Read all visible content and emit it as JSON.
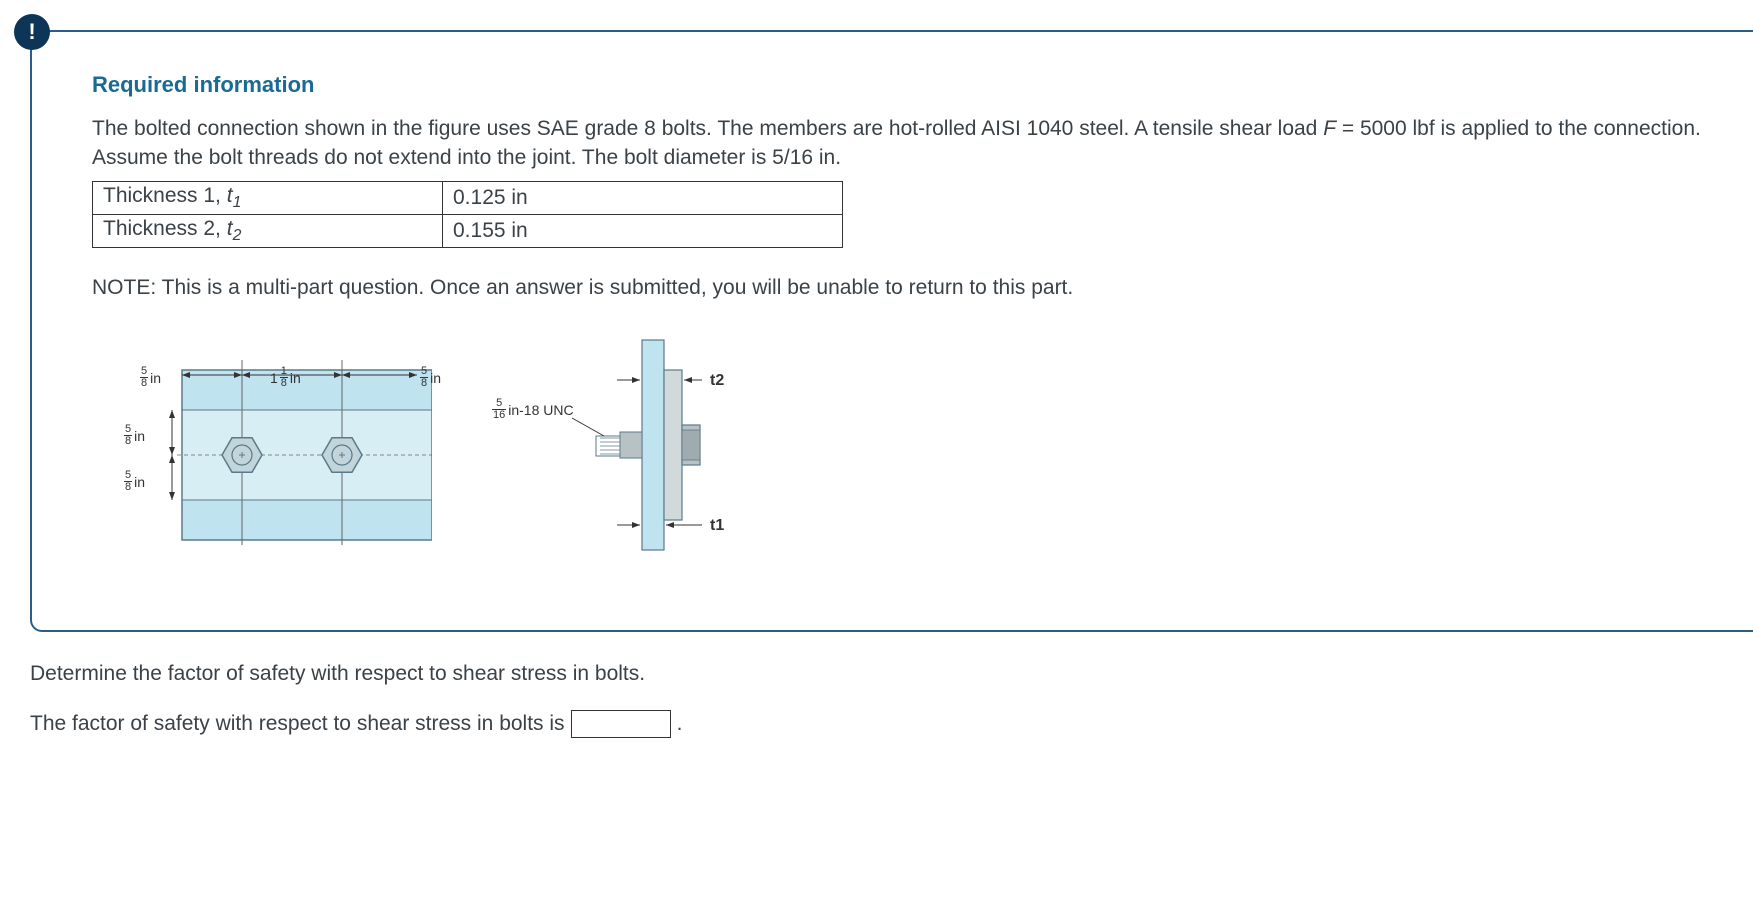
{
  "panel": {
    "heading": "Required information",
    "body_line1": "The bolted connection shown in the figure uses SAE grade 8 bolts. The members are hot-rolled AISI 1040 steel. A tensile shear load ",
    "body_force_var": "F",
    "body_line2": " = 5000 lbf is applied to the connection. Assume the bolt threads do not extend into the joint. The bolt diameter is 5/16 in.",
    "table": [
      {
        "label_text": "Thickness 1, ",
        "label_var": "t",
        "label_sub": "1",
        "value": "0.125 in"
      },
      {
        "label_text": "Thickness 2, ",
        "label_var": "t",
        "label_sub": "2",
        "value": "0.155 in"
      }
    ],
    "note": "NOTE: This is a multi-part question. Once an answer is submitted, you will be unable to return to this part."
  },
  "figure": {
    "left": {
      "dim_top_left_num": "5",
      "dim_top_left_den": "8",
      "dim_top_left_unit": "in",
      "dim_top_mid_whole": "1",
      "dim_top_mid_num": "1",
      "dim_top_mid_den": "8",
      "dim_top_mid_unit": "in",
      "dim_top_right_num": "5",
      "dim_top_right_den": "8",
      "dim_top_right_unit": "in",
      "dim_side_upper_num": "5",
      "dim_side_upper_den": "8",
      "dim_side_upper_unit": "in",
      "dim_side_lower_num": "5",
      "dim_side_lower_den": "8",
      "dim_side_lower_unit": "in"
    },
    "right": {
      "thread_num": "5",
      "thread_den": "16",
      "thread_text": "in-18 UNC",
      "t2_label": "t2",
      "t1_label": "t1"
    }
  },
  "question": {
    "prompt": "Determine the factor of safety with respect to shear stress in bolts.",
    "answer_prefix": "The factor of safety with respect to shear stress in bolts is",
    "answer_suffix": "."
  }
}
